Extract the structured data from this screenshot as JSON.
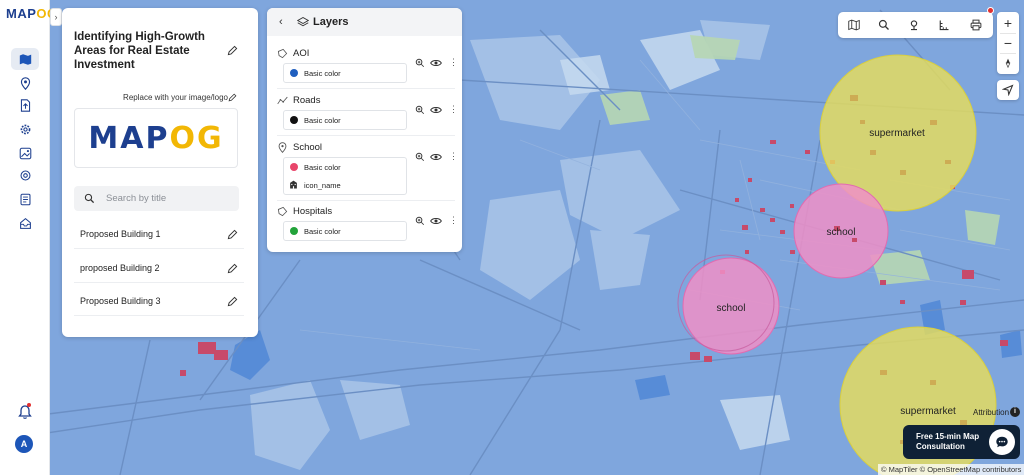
{
  "brand": {
    "name_part1": "MAP",
    "name_part2": "OG"
  },
  "project": {
    "title": "Identifying High-Growth Areas for Real Estate Investment",
    "replace_logo_label": "Replace with your image/logo",
    "logo_part1": "MAP",
    "logo_part2": "OG",
    "search_placeholder": "Search by title",
    "items": [
      {
        "label": "Proposed Building 1"
      },
      {
        "label": "proposed Building 2"
      },
      {
        "label": "Proposed Building 3"
      }
    ]
  },
  "layers": {
    "title": "Layers",
    "items": [
      {
        "name": "AOI",
        "type_icon": "polygon-icon",
        "styles": [
          {
            "label": "Basic color",
            "color": "#1f5fbf"
          }
        ]
      },
      {
        "name": "Roads",
        "type_icon": "line-icon",
        "styles": [
          {
            "label": "Basic color",
            "color": "#111111"
          }
        ]
      },
      {
        "name": "School",
        "type_icon": "pin-icon",
        "styles": [
          {
            "label": "Basic color",
            "color": "#e8456a"
          },
          {
            "label": "icon_name",
            "icon": "building-icon"
          }
        ]
      },
      {
        "name": "Hospitals",
        "type_icon": "polygon-icon",
        "styles": [
          {
            "label": "Basic color",
            "color": "#22a33a"
          }
        ]
      }
    ]
  },
  "map": {
    "labels": {
      "supermarket_1": "supermarket",
      "supermarket_2": "supermarket",
      "school_1": "school",
      "school_2": "school"
    },
    "colors": {
      "base": "#7fa6dd",
      "supermarket": "#e6dd5c",
      "school": "#ee8fc7",
      "buildings": "#c74a6a"
    }
  },
  "toolbar": {
    "icons": [
      "map-icon",
      "search-icon",
      "pin-icon",
      "ruler-icon",
      "print-icon"
    ]
  },
  "zoom": {
    "in": "+",
    "out": "−"
  },
  "attribution": "Attribution",
  "consult_label": "Free 15-min Map Consultation",
  "credits": "© MapTiler © OpenStreetMap contributors",
  "user_initial": "A"
}
